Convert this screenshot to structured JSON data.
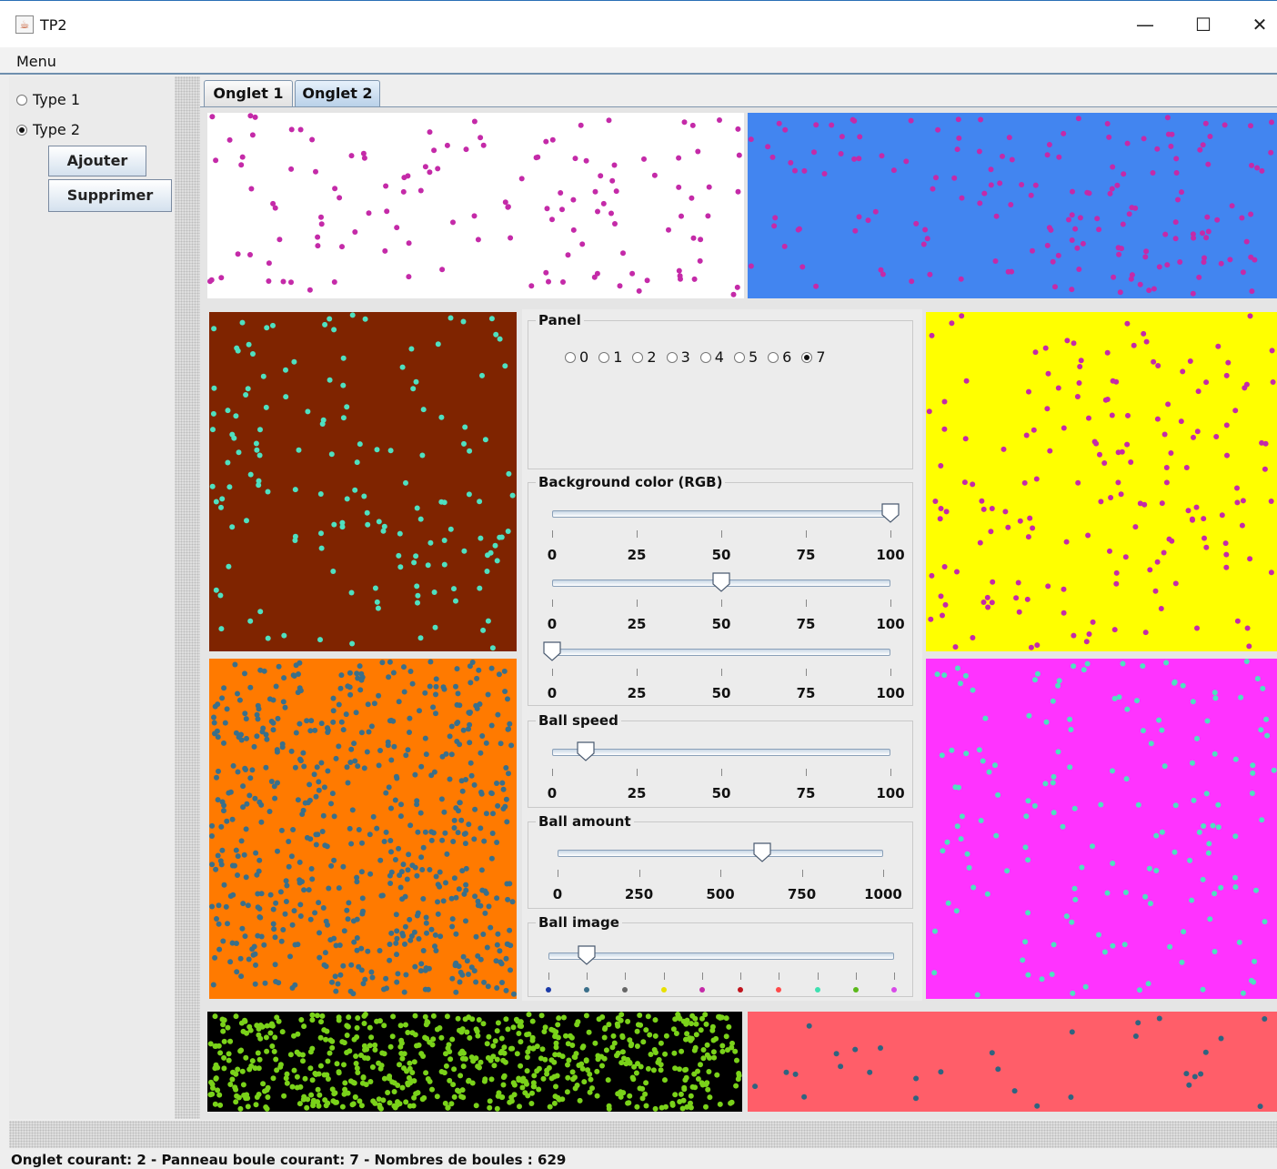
{
  "window": {
    "title": "TP2",
    "minimize": "—",
    "maximize": "☐",
    "close": "✕"
  },
  "menu": {
    "label": "Menu"
  },
  "left": {
    "radios": [
      {
        "label": "Type 1",
        "checked": false
      },
      {
        "label": "Type 2",
        "checked": true
      }
    ],
    "add_label": "Ajouter",
    "remove_label": "Supprimer"
  },
  "tabs": [
    {
      "label": "Onglet 1",
      "active": false
    },
    {
      "label": "Onglet 2",
      "active": true
    }
  ],
  "panels": {
    "top_left": {
      "color": "#ffffff",
      "ball": "#c42aa8",
      "balls": 130
    },
    "top_right": {
      "color": "#4285f0",
      "ball": "#c42aa8",
      "balls": 170
    },
    "mid_left_top": {
      "color": "#7f2400",
      "ball": "#4fe0c0",
      "balls": 150
    },
    "mid_left_bottom": {
      "color": "#ff7a00",
      "ball": "#3a6f8a",
      "balls": 629
    },
    "mid_right_top": {
      "color": "#ffff00",
      "ball": "#c42aa8",
      "balls": 170
    },
    "mid_right_bottom": {
      "color": "#ff33ff",
      "ball": "#4fe0c0",
      "balls": 160
    },
    "bottom_left": {
      "color": "#000000",
      "ball": "#7ad21a",
      "balls": 700
    },
    "bottom_right": {
      "color": "#ff5e69",
      "ball": "#2f6480",
      "balls": 30
    }
  },
  "controls": {
    "panel_group": {
      "title": "Panel",
      "options": [
        "0",
        "1",
        "2",
        "3",
        "4",
        "5",
        "6",
        "7"
      ],
      "selected": "7"
    },
    "bg_group": {
      "title": "Background color (RGB)",
      "labels": [
        "0",
        "25",
        "50",
        "75",
        "100"
      ],
      "red": 100,
      "green": 50,
      "blue": 0
    },
    "speed_group": {
      "title": "Ball speed",
      "labels": [
        "0",
        "25",
        "50",
        "75",
        "100"
      ],
      "value": 10
    },
    "amount_group": {
      "title": "Ball amount",
      "labels": [
        "0",
        "250",
        "500",
        "750",
        "1000"
      ],
      "value": 629
    },
    "image_group": {
      "title": "Ball image",
      "value": 1,
      "ball_colors": [
        "#1b3aa8",
        "#3a6f8a",
        "#666666",
        "#e8e000",
        "#c42aa8",
        "#c0141e",
        "#ff4a4a",
        "#3ee0b0",
        "#5bb81a",
        "#d84ae8"
      ]
    }
  },
  "status": "Onglet courant: 2 - Panneau boule courant: 7 - Nombres de boules : 629"
}
